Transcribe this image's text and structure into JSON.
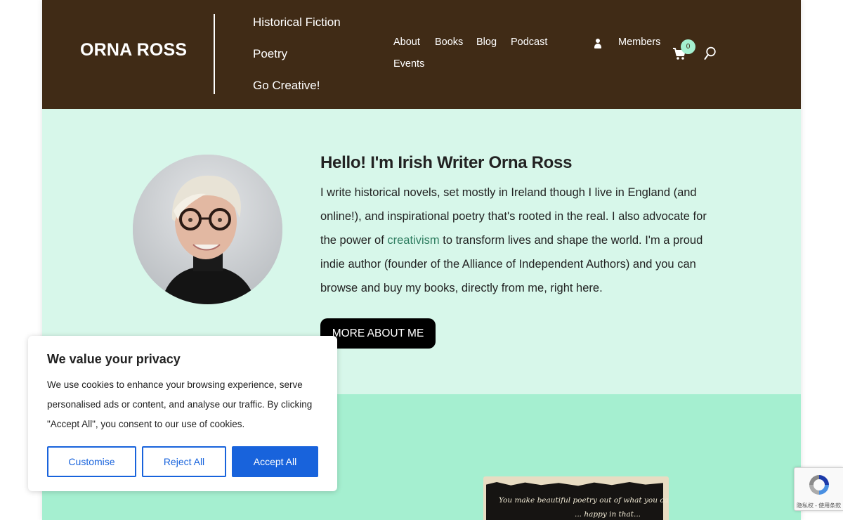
{
  "header": {
    "logo": "ORNA ROSS",
    "categories": [
      "Historical Fiction",
      "Poetry",
      "Go Creative!"
    ],
    "nav": {
      "about": "About",
      "books": "Books",
      "blog": "Blog",
      "podcast": "Podcast",
      "events": "Events",
      "members": "Members"
    },
    "cart_count": "0",
    "colors": {
      "background": "#402b16",
      "badge": "#a4f0d0"
    }
  },
  "hero": {
    "title": "Hello! I'm Irish Writer Orna Ross",
    "text_before": "I write historical novels, set mostly in Ireland though I live in England (and online!), and inspirational poetry that's rooted in the real. I also advocate for the power of ",
    "link": "creativism",
    "text_after": " to transform lives and shape the world. I'm a proud indie author (founder of the Alliance of Independent Authors) and you can browse and buy my books, directly from me, right here.",
    "button": "MORE ABOUT ME",
    "colors": {
      "background": "#d7f7ea",
      "link": "#2e7d60"
    }
  },
  "book_section": {
    "quote_line1": "You make beautiful poetry out of what you call your",
    "quote_line2": "... happy in that...",
    "colors": {
      "background": "#a5efd0"
    }
  },
  "cookie_banner": {
    "title": "We value your privacy",
    "text": "We use cookies to enhance your browsing experience, serve personalised ads or content, and analyse our traffic. By clicking \"Accept All\", you consent to our use of cookies.",
    "customise": "Customise",
    "reject": "Reject All",
    "accept": "Accept All",
    "colors": {
      "accent": "#1863dc"
    }
  },
  "recaptcha": {
    "label": "隐私权 - 使用条款"
  },
  "icons": [
    "user-icon",
    "cart-icon",
    "search-icon",
    "recaptcha-icon"
  ]
}
